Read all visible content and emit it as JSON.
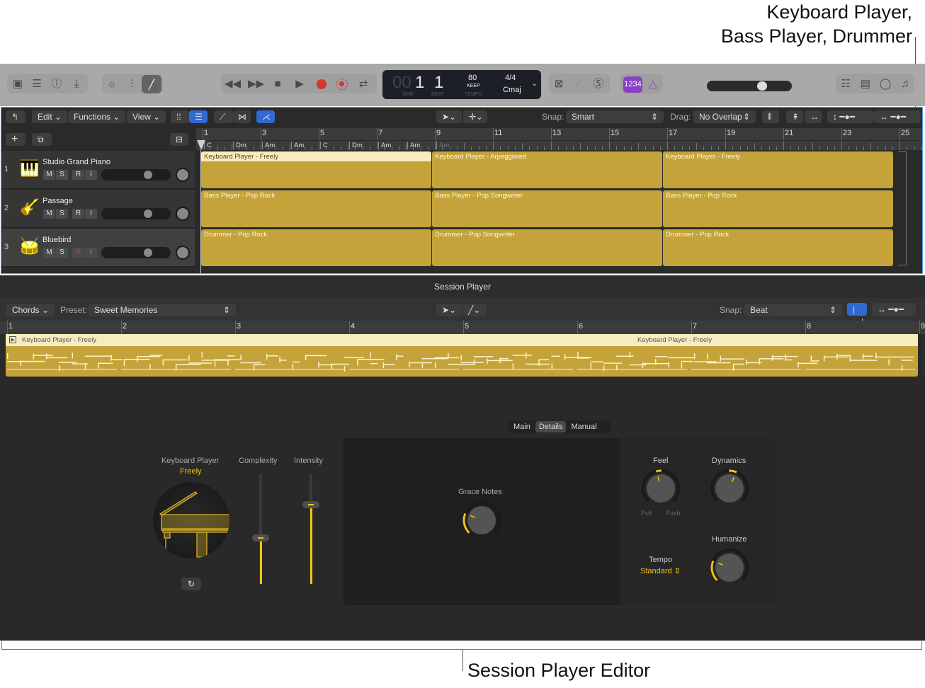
{
  "callouts": {
    "top_line1": "Keyboard Player,",
    "top_line2": "Bass Player, Drummer",
    "bottom": "Session Player Editor"
  },
  "control_bar": {
    "lcd": {
      "bar_prefix": "00",
      "bar": "1",
      "beat": "1",
      "bar_label": "BAR",
      "beat_label": "BEAT",
      "tempo": "80",
      "tempo_mode": "KEEP",
      "tempo_label": "TEMPO",
      "time_signature": "4/4",
      "key": "Cmaj"
    },
    "count_in": "1234",
    "master_volume": 0.68,
    "icons": [
      "library-icon",
      "inspector-icon",
      "quick-help-icon",
      "download-icon",
      "smart-controls-icon",
      "mixer-icon",
      "editors-icon",
      "rewind-icon",
      "fast-forward-icon",
      "stop-icon",
      "play-icon",
      "record-icon",
      "replace-record-icon",
      "cycle-icon",
      "mute-icon",
      "tuner-icon",
      "solo-icon",
      "metronome-icon",
      "list-editors-icon",
      "notepad-icon",
      "loop-browser-icon",
      "browser-icon"
    ]
  },
  "tracks_toolbar": {
    "edit": "Edit",
    "functions": "Functions",
    "view": "View",
    "snap_label": "Snap:",
    "snap_value": "Smart",
    "drag_label": "Drag:",
    "drag_value": "No Overlap"
  },
  "ruler": {
    "bars": [
      "1",
      "3",
      "5",
      "7",
      "9",
      "11",
      "13",
      "15",
      "17",
      "19",
      "21",
      "23",
      "25"
    ],
    "chords": [
      "C",
      "Dm",
      "Am",
      "Am",
      "C",
      "Dm",
      "Am",
      "Am",
      "Am"
    ]
  },
  "tracks": [
    {
      "number": "1",
      "name": "Studio Grand Piano",
      "icon": "piano-icon",
      "volume": 0.7,
      "regions": [
        "Keyboard Player - Freely",
        "Keyboard Player - Arpeggiated",
        "Keyboard Player - Freely"
      ]
    },
    {
      "number": "2",
      "name": "Passage",
      "icon": "bass-guitar-icon",
      "volume": 0.7,
      "regions": [
        "Bass Player - Pop Rock",
        "Bass Player - Pop Songwriter",
        "Bass Player - Pop Rock"
      ]
    },
    {
      "number": "3",
      "name": "Bluebird",
      "icon": "drum-kit-icon",
      "volume": 0.7,
      "regions": [
        "Drummer - Pop Rock",
        "Drummer - Pop Songwriter",
        "Drummer - Pop Rock"
      ]
    }
  ],
  "track_buttons": {
    "mute": "M",
    "solo": "S",
    "record": "R",
    "input": "I"
  },
  "colors": {
    "region": "#c4a33a",
    "accent": "#f1c40f",
    "selection": "#5aa0ea",
    "count_in": "#8a3fc7"
  },
  "editor": {
    "title": "Session Player",
    "chords_button": "Chords",
    "preset_label": "Preset:",
    "preset_value": "Sweet Memories",
    "snap_label": "Snap:",
    "snap_value": "Beat",
    "ruler_bars": [
      "1",
      "2",
      "3",
      "4",
      "5",
      "6",
      "7",
      "8",
      "9"
    ],
    "region_label": "Keyboard Player - Freely",
    "tabs": [
      {
        "label": "Main",
        "selected": false
      },
      {
        "label": "Details",
        "selected": true
      },
      {
        "label": "Manual",
        "selected": false
      }
    ],
    "player": {
      "name": "Keyboard Player",
      "style": "Freely"
    },
    "complexity": {
      "label": "Complexity",
      "value": 0.42
    },
    "intensity": {
      "label": "Intensity",
      "value": 0.72
    },
    "grace_notes": {
      "label": "Grace Notes",
      "value": 0.25
    },
    "feel": {
      "label": "Feel",
      "min_label": "Pull",
      "max_label": "Push",
      "value": 0.45
    },
    "dynamics": {
      "label": "Dynamics",
      "value": 0.58
    },
    "humanize": {
      "label": "Humanize",
      "value": 0.25
    },
    "tempo": {
      "label": "Tempo",
      "value": "Standard"
    }
  }
}
